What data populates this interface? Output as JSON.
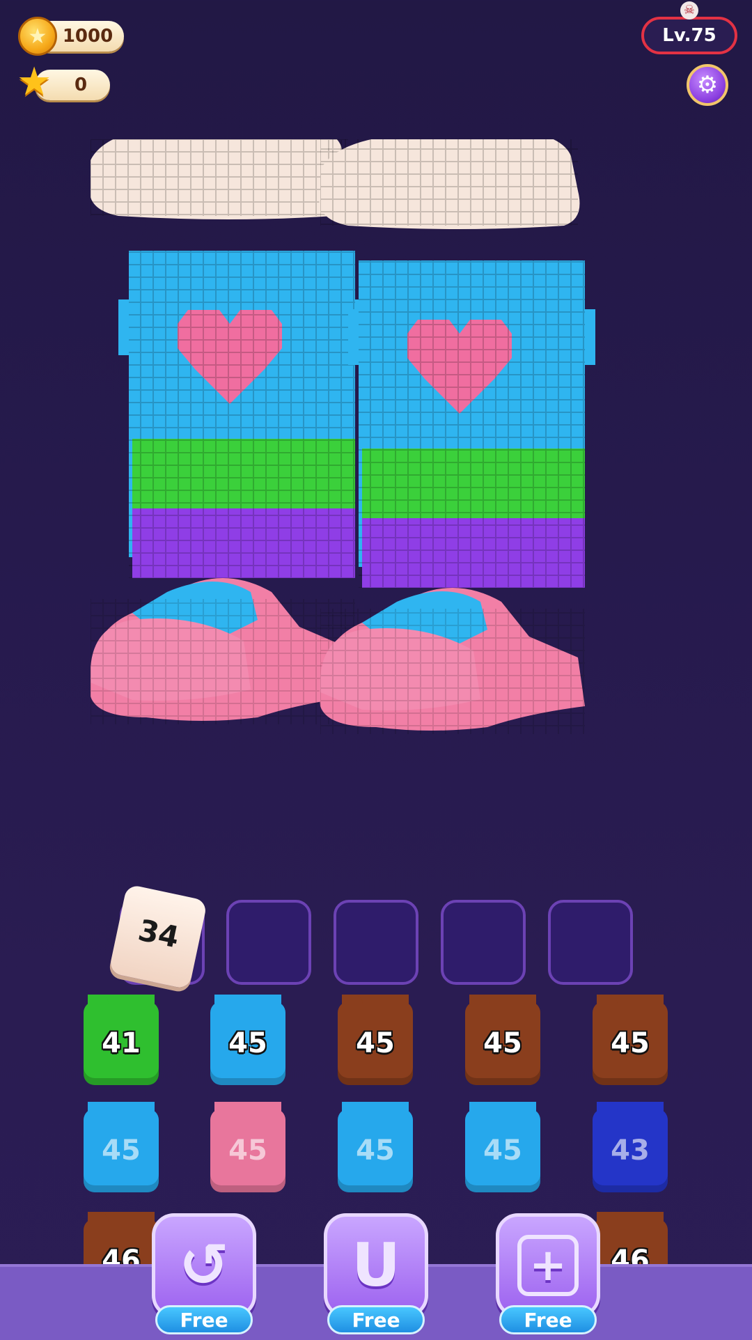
{
  "hud": {
    "coins": "1000",
    "stars": "0",
    "level": "Lv.75",
    "coin_icon": "coin-icon",
    "star_icon": "star-icon",
    "settings_icon": "gear-icon",
    "level_badge_icon": "skull-icon"
  },
  "model": {
    "subject": "voxel boots",
    "colors": {
      "fur": "#f6e6dc",
      "leg": "#2fb5f0",
      "heart": "#f06ea0",
      "stripe1": "#3bd03b",
      "stripe2": "#8f3ee6",
      "foot": "#f27fa6",
      "foot_band": "#2fb5f0"
    }
  },
  "slots": {
    "held_block": "34",
    "count": 5
  },
  "tiles": {
    "row1": [
      {
        "num": "41",
        "color": "#2fbf2f"
      },
      {
        "num": "45",
        "color": "#26a8ec"
      },
      {
        "num": "45",
        "color": "#8a3e1d"
      },
      {
        "num": "45",
        "color": "#8a3e1d"
      },
      {
        "num": "45",
        "color": "#8a3e1d"
      }
    ],
    "row2": [
      {
        "num": "45",
        "color": "#26a8ec"
      },
      {
        "num": "45",
        "color": "#e8769c"
      },
      {
        "num": "45",
        "color": "#26a8ec"
      },
      {
        "num": "45",
        "color": "#26a8ec"
      },
      {
        "num": "43",
        "color": "#2435c8"
      }
    ],
    "row3": [
      {
        "num": "46",
        "color": "#8a3e1d"
      },
      {
        "num": "46",
        "color": "#8a3e1d"
      }
    ]
  },
  "buttons": {
    "undo": {
      "icon": "undo-icon",
      "label": "Free"
    },
    "magnet": {
      "icon": "magnet-icon",
      "label": "Free"
    },
    "add_slot": {
      "icon": "add-slot-icon",
      "label": "Free"
    }
  }
}
